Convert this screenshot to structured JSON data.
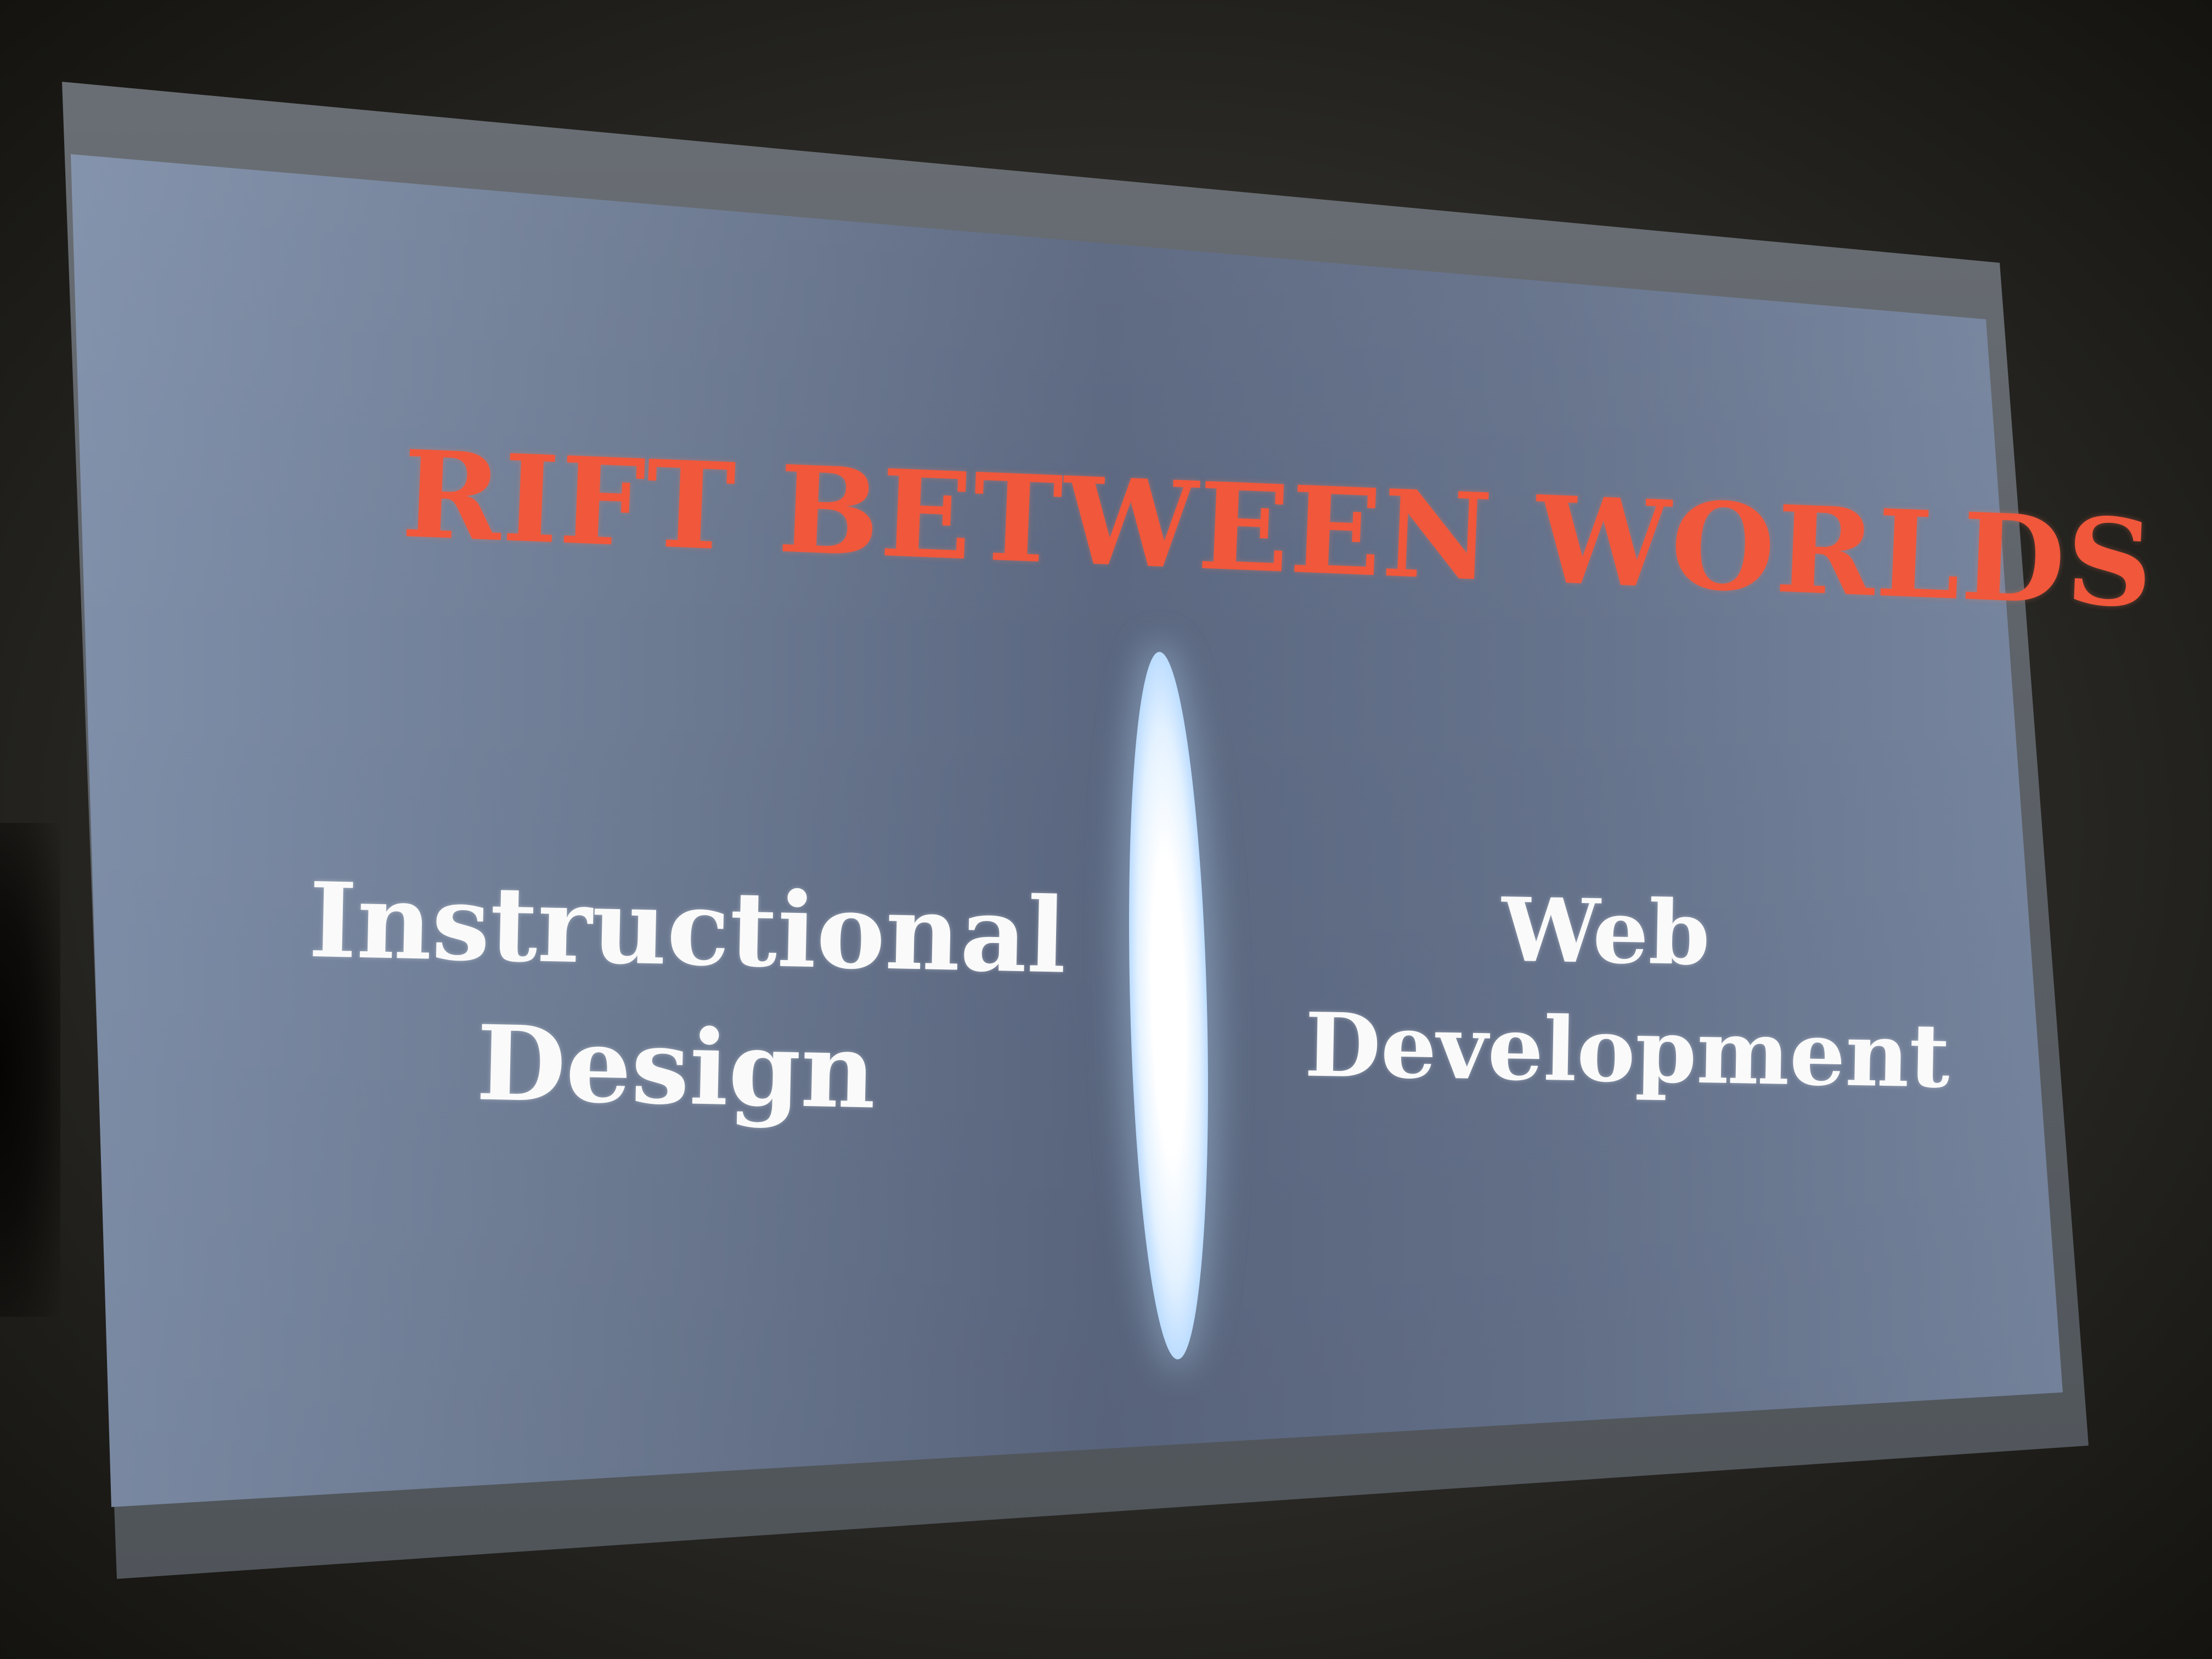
{
  "slide": {
    "title": "RIFT BETWEEN WORLDS",
    "left_topic": {
      "line1": "Instructional",
      "line2": "Design"
    },
    "right_topic": {
      "line1": "Web",
      "line2": "Development"
    }
  },
  "colors": {
    "title": "#f0573b",
    "text": "#fafafa",
    "slide_background": "#6c7a92",
    "divider_glow": "#ffffff"
  }
}
